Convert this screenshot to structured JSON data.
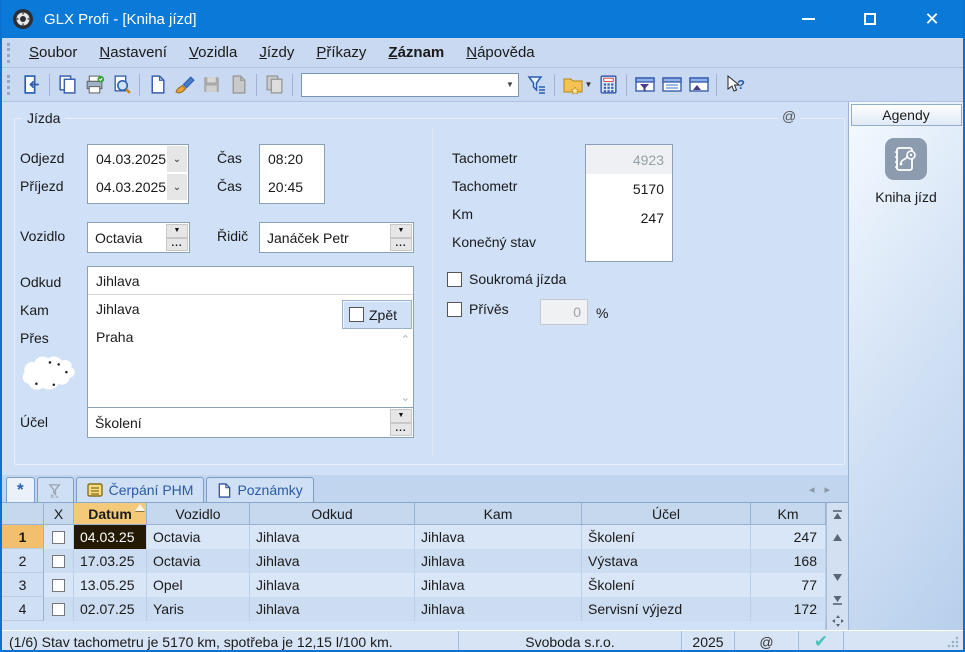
{
  "window": {
    "title": "GLX Profi - [Kniha jízd]"
  },
  "menu": {
    "items": [
      {
        "label": "Soubor"
      },
      {
        "label": "Nastavení"
      },
      {
        "label": "Vozidla"
      },
      {
        "label": "Jízdy"
      },
      {
        "label": "Příkazy"
      },
      {
        "label": "Záznam"
      },
      {
        "label": "Nápověda"
      }
    ]
  },
  "toolbar": {
    "icons": [
      "exit-icon",
      "copy-icon",
      "print-icon",
      "preview-icon",
      "new-icon",
      "brush-icon",
      "save-icon",
      "delete-doc-icon",
      "duplicate-icon",
      "filter-icon",
      "folder-icon",
      "calculator-icon",
      "view-filter-icon",
      "view-detail-icon",
      "view-panel-icon",
      "help-icon"
    ],
    "search_value": ""
  },
  "form": {
    "legend": "Jízda",
    "at": "@",
    "odjezd_label": "Odjezd",
    "odjezd_value": "04.03.2025",
    "prijezd_label": "Příjezd",
    "prijezd_value": "04.03.2025",
    "cas1_label": "Čas",
    "cas1_value": "08:20",
    "cas2_label": "Čas",
    "cas2_value": "20:45",
    "vozidlo_label": "Vozidlo",
    "vozidlo_value": "Octavia",
    "ridic_label": "Řidič",
    "ridic_value": "Janáček Petr",
    "odkud_label": "Odkud",
    "odkud_value": "Jihlava",
    "kam_label": "Kam",
    "kam_value": "Jihlava",
    "pres_label": "Přes",
    "pres_value": "Praha",
    "zpet_label": "Zpět",
    "ucel_label": "Účel",
    "ucel_value": "Školení",
    "tach1_label": "Tachometr",
    "tach1_value": "4923",
    "tach2_label": "Tachometr",
    "tach2_value": "5170",
    "km_label": "Km",
    "km_value": "247",
    "konecny_label": "Konečný stav",
    "konecny_value": "",
    "soukroma_label": "Soukromá jízda",
    "prives_label": "Přívěs",
    "prives_value": "0",
    "prives_unit": "%"
  },
  "agendy": {
    "header": "Agendy",
    "item_label": "Kniha jízd"
  },
  "tabs": {
    "star": "*",
    "cerpani": "Čerpání PHM",
    "poznamky": "Poznámky"
  },
  "table": {
    "columns": [
      "",
      "X",
      "Datum",
      "Vozidlo",
      "Odkud",
      "Kam",
      "Účel",
      "Km"
    ],
    "rows": [
      {
        "num": "1",
        "datum": "04.03.25",
        "vozidlo": "Octavia",
        "odkud": "Jihlava",
        "kam": "Jihlava",
        "ucel": "Školení",
        "km": "247"
      },
      {
        "num": "2",
        "datum": "17.03.25",
        "vozidlo": "Octavia",
        "odkud": "Jihlava",
        "kam": "Jihlava",
        "ucel": "Výstava",
        "km": "168"
      },
      {
        "num": "3",
        "datum": "13.05.25",
        "vozidlo": "Opel",
        "odkud": "Jihlava",
        "kam": "Jihlava",
        "ucel": "Školení",
        "km": "77"
      },
      {
        "num": "4",
        "datum": "02.07.25",
        "vozidlo": "Yaris",
        "odkud": "Jihlava",
        "kam": "Jihlava",
        "ucel": "Servisní výjezd",
        "km": "172"
      }
    ]
  },
  "status": {
    "message": "(1/6) Stav tachometru je 5170 km, spotřeba je 12,15 l/100 km.",
    "company": "Svoboda s.r.o.",
    "year": "2025",
    "at": "@"
  },
  "colors": {
    "titlebar": "#0b79d7",
    "bar_bg": "#c8d9f1",
    "form_bg": "#cfe0f7",
    "selected_row_header": "#f2c06c",
    "sorted_column_header": "#f4c979",
    "selected_cell_bg": "#241a03",
    "status_check": "#49c2ba"
  }
}
